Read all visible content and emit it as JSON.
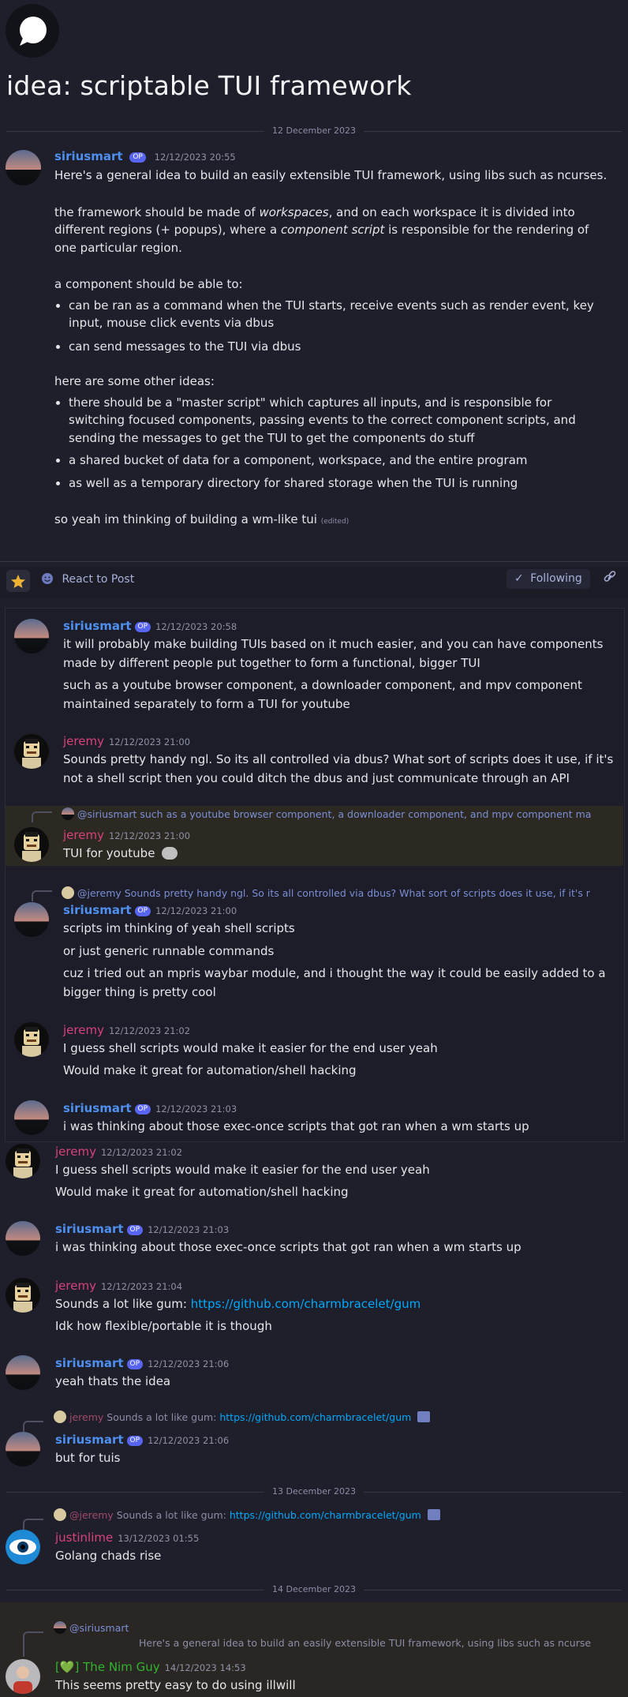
{
  "post": {
    "title": "idea: scriptable TUI framework",
    "op_badge": "OP",
    "first_date": "12 December 2023",
    "author": "siriusmart",
    "time": "12/12/2023 20:55",
    "p1": "Here's a general idea to build an easily extensible TUI framework, using libs such as ncurses.",
    "p2a": "the framework should be made of ",
    "p2b": "workspaces",
    "p2c": ", and on each workspace it is divided into",
    "p2d": "different regions (+ popups), where a ",
    "p2e": "component script",
    "p2f": " is responsible for the rendering of",
    "p2g": "one particular region.",
    "p3": "a component should be able to:",
    "b1a": "can be ran as a command when the TUI starts, receive events such as render event, key",
    "b1b": "input, mouse click events via dbus",
    "b2": "can send messages to the TUI via dbus",
    "p4": "here are some other ideas:",
    "b3a": "there should be a \"master script\" which captures all inputs, and is responsible for",
    "b3b": "switching focused components, passing events to the correct component scripts, and",
    "b3c": "sending the messages to get the TUI to get the components do stuff",
    "b4": "a shared bucket of data for a component, workspace, and the entire program",
    "b5": "as well as a temporary directory for shared storage when the TUI is running",
    "p5": "so yeah im thinking of building a wm-like tui",
    "edited": "(edited)"
  },
  "toolbar": {
    "react": "React to Post",
    "following": "Following"
  },
  "quoted": {
    "m1_user": "siriusmart",
    "m1_time": "12/12/2023 20:58",
    "m1_l1": "it will probably make building TUIs based on it much easier, and you can have components",
    "m1_l2": "made by different people put together to form a functional, bigger TUI",
    "m1_l3": "such as a youtube browser component, a downloader component, and mpv component",
    "m1_l4": "maintained separately to form a TUI for youtube",
    "m2_user": "jeremy",
    "m2_time": "12/12/2023 21:00",
    "m2_l1": "Sounds pretty handy ngl. So its all controlled via dbus? What sort of scripts does it use, if it's",
    "m2_l2": "not a shell script then you could ditch the dbus and just communicate through an API",
    "m3_reply": "@siriusmart such as a youtube browser component, a downloader component, and mpv component ma",
    "m3_user": "jeremy",
    "m3_time": "12/12/2023 21:00",
    "m3_l1": "TUI for youtube",
    "m4_reply": "@jeremy Sounds pretty handy ngl. So its all controlled via dbus? What sort of scripts does it use, if it's r",
    "m4_user": "siriusmart",
    "m4_time": "12/12/2023 21:00",
    "m4_l1": "scripts im thinking of yeah shell scripts",
    "m4_l2": "or just generic runnable commands",
    "m4_l3": "cuz i tried out an mpris waybar module, and i thought the way it could be easily added to a",
    "m4_l4": "bigger thing is pretty cool",
    "m5_user": "jeremy",
    "m5_time": "12/12/2023 21:02",
    "m5_l1": "I guess shell scripts would make it easier for the end user yeah",
    "m5_l2": "Would make it great for automation/shell hacking",
    "m6_user": "siriusmart",
    "m6_time": "12/12/2023 21:03",
    "m6_l1": "i was thinking about those exec-once scripts that got ran when a wm starts up"
  },
  "thread": {
    "t1_user": "jeremy",
    "t1_time": "12/12/2023 21:02",
    "t1_l1": "I guess shell scripts would make it easier for the end user yeah",
    "t1_l2": "Would make it great for automation/shell hacking",
    "t2_user": "siriusmart",
    "t2_time": "12/12/2023 21:03",
    "t2_l1": "i was thinking about those exec-once scripts that got ran when a wm starts up",
    "t3_user": "jeremy",
    "t3_time": "12/12/2023 21:04",
    "t3_l1a": "Sounds a lot like gum: ",
    "t3_link": "https://github.com/charmbracelet/gum",
    "t3_l2": "Idk how flexible/portable it is though",
    "t4_user": "siriusmart",
    "t4_time": "12/12/2023 21:06",
    "t4_l1": "yeah thats the idea",
    "t5_reply_user": "jeremy",
    "t5_reply_text": " Sounds a lot like gum: ",
    "t5_reply_link": "https://github.com/charmbracelet/gum",
    "t5_user": "siriusmart",
    "t5_time": "12/12/2023 21:06",
    "t5_l1": "but for tuis",
    "date2": "13 December 2023",
    "t6_reply_user": "@jeremy",
    "t6_reply_text": " Sounds a lot like gum: ",
    "t6_reply_link": "https://github.com/charmbracelet/gum",
    "t6_user": "justinlime",
    "t6_time": "13/12/2023 01:55",
    "t6_l1": "Golang chads rise",
    "date3": "14 December 2023",
    "t7_reply_user": "@siriusmart",
    "t7_reply_text": "Here's a general idea to build an easily extensible TUI framework, using libs such as ncurse",
    "t7_user": "[💚] The Nim Guy",
    "t7_time": "14/12/2023 14:53",
    "t7_l1": "This seems pretty easy to do using illwill"
  },
  "colors": {
    "background": "#1e1f2a",
    "username_blue": "#4e8ff0",
    "username_pink": "#d9427a",
    "username_green": "#2fb52f",
    "link": "#00a8fc",
    "op_badge": "#5865f2"
  }
}
